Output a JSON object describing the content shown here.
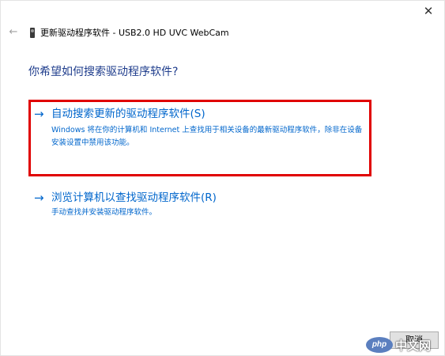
{
  "window": {
    "close_symbol": "✕"
  },
  "header": {
    "back_symbol": "←",
    "device_icon": "webcam-device-icon",
    "title": "更新驱动程序软件 - USB2.0 HD UVC WebCam"
  },
  "question": "你希望如何搜索驱动程序软件?",
  "options": [
    {
      "arrow": "→",
      "title": "自动搜索更新的驱动程序软件(S)",
      "description": "Windows 将在你的计算机和 Internet 上查找用于相关设备的最新驱动程序软件，除非在设备安装设置中禁用该功能。"
    },
    {
      "arrow": "→",
      "title": "浏览计算机以查找驱动程序软件(R)",
      "description": "手动查找并安装驱动程序软件。"
    }
  ],
  "footer": {
    "cancel_label": "取消"
  },
  "watermark": {
    "logo_text": "php",
    "site_text": "中文网"
  },
  "colors": {
    "link": "#0066cc",
    "question": "#1e3c8c",
    "highlight_border": "#e00000"
  }
}
